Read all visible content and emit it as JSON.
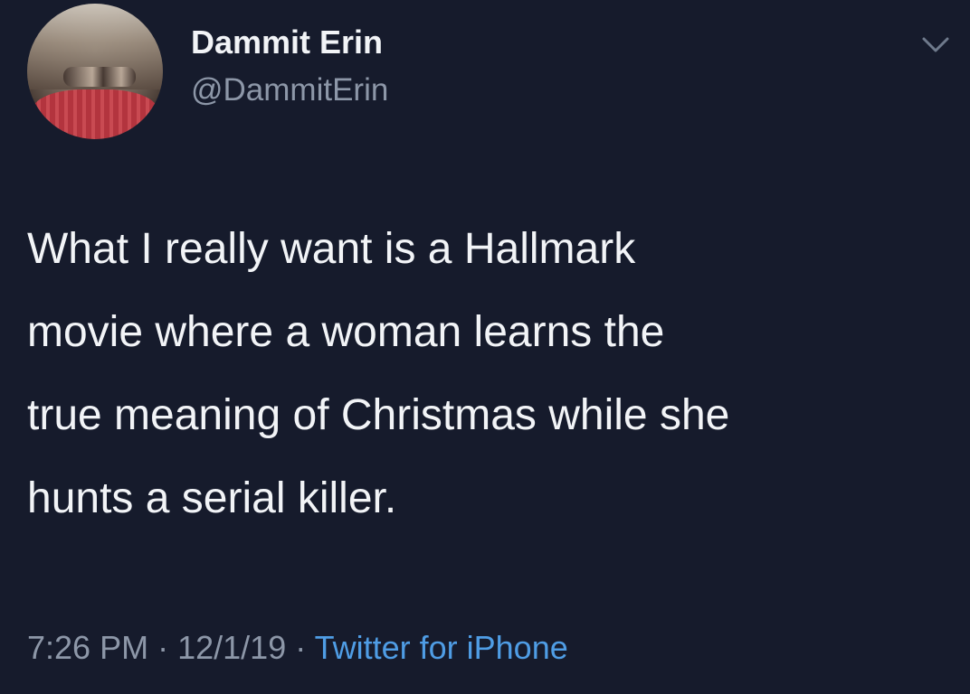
{
  "user": {
    "display_name": "Dammit Erin",
    "handle": "@DammitErin"
  },
  "tweet": {
    "lines": [
      "What I really want is a Hallmark",
      "movie where a woman learns the",
      "true meaning of Christmas while she",
      "hunts a serial killer."
    ],
    "time": "7:26 PM",
    "date": "12/1/19",
    "separator": "·",
    "source": "Twitter for iPhone"
  },
  "icons": {
    "caret": "chevron-down-icon",
    "avatar": "avatar"
  },
  "colors": {
    "background": "#161b2c",
    "text": "#f2f4f7",
    "muted": "#8d97a8",
    "link": "#4f9de5"
  }
}
